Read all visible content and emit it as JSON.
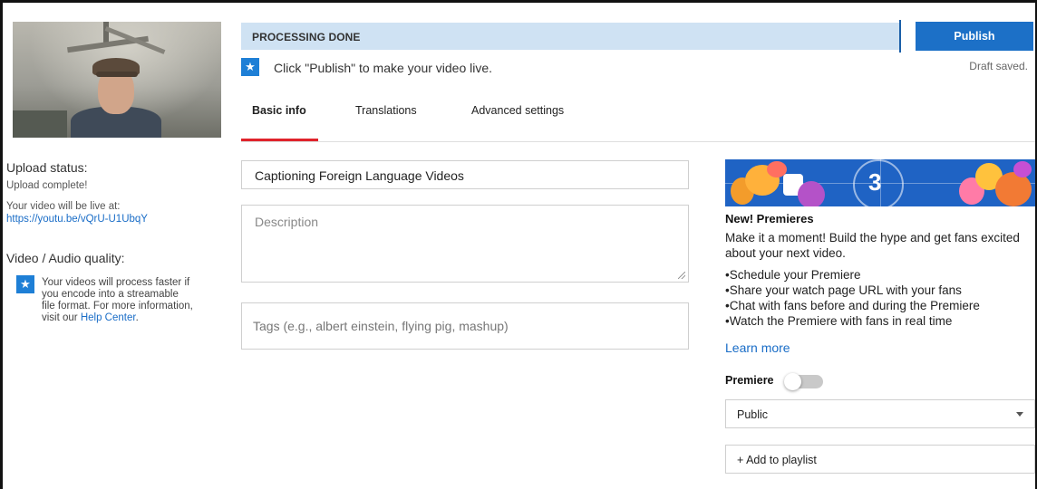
{
  "sidebar": {
    "upload_status_heading": "Upload status:",
    "upload_status_value": "Upload complete!",
    "live_at_label": "Your video will be live at:",
    "video_url": "https://youtu.be/vQrU-U1UbqY",
    "quality_heading": "Video / Audio quality:",
    "quality_info_text": "Your videos will process faster if you encode into a streamable file format. For more information, visit our",
    "help_center_link": "Help Center",
    "help_center_suffix": "."
  },
  "processing": {
    "status": "PROCESSING DONE",
    "hint": "Click \"Publish\" to make your video live."
  },
  "header": {
    "publish_label": "Publish",
    "draft_status": "Draft saved."
  },
  "tabs": [
    {
      "label": "Basic info",
      "active": true
    },
    {
      "label": "Translations",
      "active": false
    },
    {
      "label": "Advanced settings",
      "active": false
    }
  ],
  "form": {
    "title_value": "Captioning Foreign Language Videos",
    "description_placeholder": "Description",
    "tags_placeholder": "Tags (e.g., albert einstein, flying pig, mashup)"
  },
  "premieres": {
    "banner_number": "3",
    "title": "New! Premieres",
    "description": "Make it a moment! Build the hype and get fans excited about your next video.",
    "bullets": [
      "Schedule your Premiere",
      "Share your watch page URL with your fans",
      "Chat with fans before and during the Premiere",
      "Watch the Premiere with fans in real time"
    ],
    "learn_more": "Learn more",
    "toggle_label": "Premiere",
    "toggle_on": false
  },
  "visibility": {
    "selected": "Public"
  },
  "playlist": {
    "label": "+ Add to playlist"
  },
  "colors": {
    "accent": "#1c70c7",
    "banner_bg": "#cfe2f3",
    "tab_active_underline": "#e0232b",
    "link": "#1a6dc7"
  },
  "icons": {
    "info_star": "star-icon",
    "dropdown": "chevron-down-icon"
  }
}
